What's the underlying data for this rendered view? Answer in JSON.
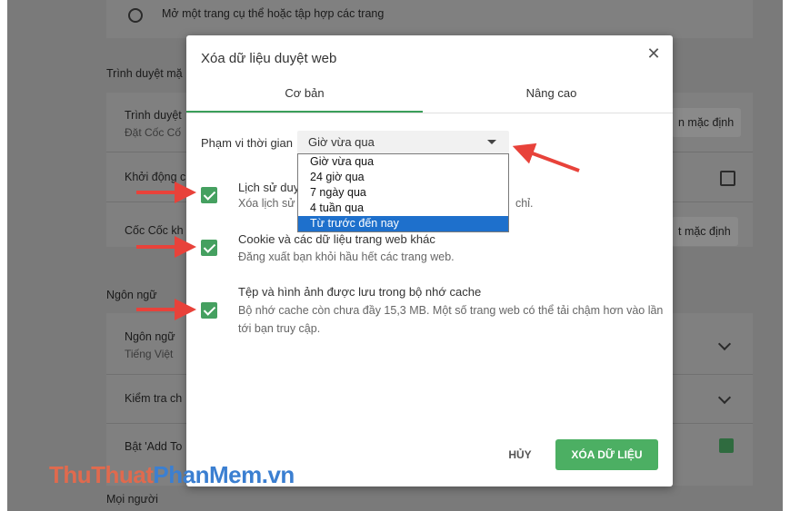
{
  "background": {
    "top_option": "Mở một trang cụ thể hoặc tập hợp các trang",
    "section_browser": "Trình duyệt mặ",
    "row_default_browser": {
      "title": "Trình duyệt",
      "sub": "Đặt Cốc Cố",
      "button": "n mặc định"
    },
    "row_startup": {
      "title": "Khởi động c"
    },
    "row_coccoc": {
      "title": "Cốc Cốc kh",
      "button": "t mặc định"
    },
    "section_language": "Ngôn ngữ",
    "row_language": {
      "title": "Ngôn ngữ",
      "sub": "Tiếng Việt"
    },
    "row_spellcheck": {
      "title": "Kiểm tra ch"
    },
    "row_addto": {
      "title": "Bật 'Add To"
    },
    "section_people": "Mọi người"
  },
  "dialog": {
    "title": "Xóa dữ liệu duyệt web",
    "close_glyph": "✕",
    "tabs": [
      {
        "label": "Cơ bản",
        "active": true
      },
      {
        "label": "Nâng cao",
        "active": false
      }
    ],
    "range_label": "Phạm vi thời gian",
    "range_selected": "Giờ vừa qua",
    "range_options": [
      "Giờ vừa qua",
      "24 giờ qua",
      "7 ngày qua",
      "4 tuần qua",
      "Từ trước đến nay"
    ],
    "range_highlighted": "Từ trước đến nay",
    "items": [
      {
        "title": "Lịch sử duy",
        "desc": "Xóa lịch sử",
        "desc_tail": "chỉ.",
        "checked": true
      },
      {
        "title": "Cookie và các dữ liệu trang web khác",
        "desc": "Đăng xuất bạn khỏi hầu hết các trang web.",
        "checked": true
      },
      {
        "title": "Tệp và hình ảnh được lưu trong bộ nhớ cache",
        "desc": "Bộ nhớ cache còn chưa đầy 15,3 MB. Một số trang web có thể tải chậm hơn vào lần tới bạn truy cập.",
        "checked": true
      }
    ],
    "cancel_label": "HỦY",
    "clear_label": "XÓA DỮ LIỆU"
  },
  "watermark": {
    "part1": "ThuThuat",
    "part2": "PhanMem",
    "part3": ".vn"
  },
  "colors": {
    "accent_green": "#4caf63",
    "highlight_blue": "#1e70cc",
    "arrow_red": "#e8423a"
  }
}
